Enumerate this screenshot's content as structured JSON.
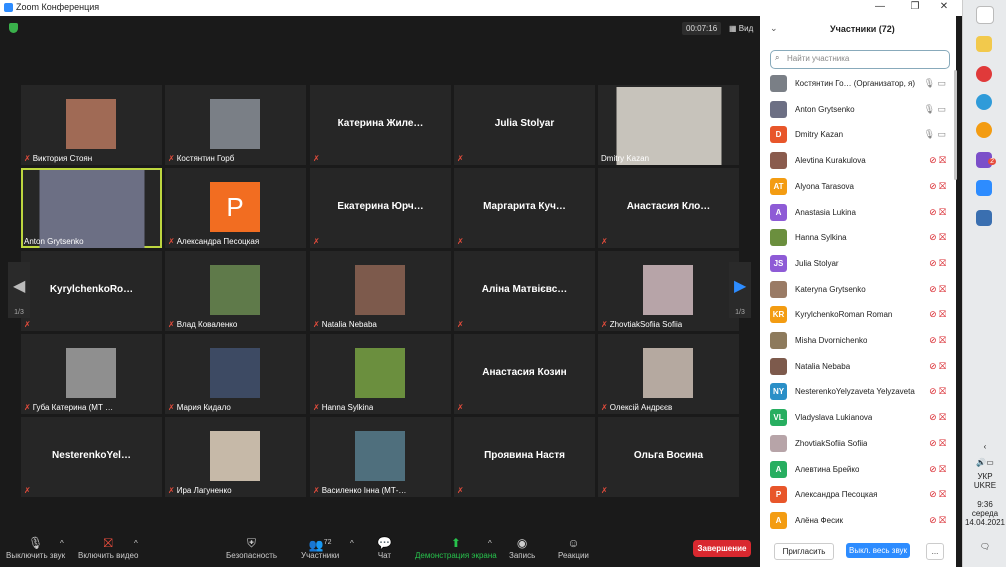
{
  "window": {
    "title": "Zoom Конференция"
  },
  "meeting": {
    "timer": "00:07:16",
    "view_label": "Вид",
    "page_indicator": "1/3",
    "tiles": [
      {
        "name": "Виктория Стоян",
        "kind": "photo",
        "color": "#a06a55"
      },
      {
        "name": "Костянтин Горб",
        "kind": "photo",
        "color": "#7a7f86"
      },
      {
        "name": "Катерина  Жиле…",
        "kind": "text"
      },
      {
        "name": "Julia Stolyar",
        "kind": "text"
      },
      {
        "name": "Dmitry Kazan",
        "kind": "video",
        "color": "#c7c3bb"
      },
      {
        "name": "Anton Grytsenko",
        "kind": "video",
        "color": "#6c6f84",
        "active": true
      },
      {
        "name": "Александра Песоцкая",
        "kind": "initial",
        "initial": "P"
      },
      {
        "name": "Екатерина  Юрч…",
        "kind": "text"
      },
      {
        "name": "Маргарита  Куч…",
        "kind": "text"
      },
      {
        "name": "Анастасия  Кло…",
        "kind": "text"
      },
      {
        "name": "KyrylchenkoRo…",
        "kind": "text"
      },
      {
        "name": "Влад Коваленко",
        "kind": "photo",
        "color": "#5f7a4a"
      },
      {
        "name": "Natalia Nebaba",
        "kind": "photo",
        "color": "#7d5a4c"
      },
      {
        "name": "Аліна  Матвієвс…",
        "kind": "text"
      },
      {
        "name": "ZhovtiakSofiia Sofiia",
        "kind": "photo",
        "color": "#b7a4a8"
      },
      {
        "name": "Губа Катерина (МТ …",
        "kind": "photo",
        "color": "#8f8f8f"
      },
      {
        "name": "Мария Кидало",
        "kind": "photo",
        "color": "#3d4a63"
      },
      {
        "name": "Hanna Sylkina",
        "kind": "photo",
        "color": "#6b8f3e"
      },
      {
        "name": "Анастасия Козин",
        "kind": "text"
      },
      {
        "name": "Олексій Андрєєв",
        "kind": "photo",
        "color": "#b5a9a0"
      },
      {
        "name": "NesterenkoYel…",
        "kind": "text"
      },
      {
        "name": "Ира Лагуненко",
        "kind": "photo",
        "color": "#c6b9a8"
      },
      {
        "name": "Василенко Інна (МТ-…",
        "kind": "photo",
        "color": "#4f6f7d"
      },
      {
        "name": "Проявина Настя",
        "kind": "text"
      },
      {
        "name": "Ольга Восина",
        "kind": "text"
      }
    ]
  },
  "toolbar": {
    "mute": "Выключить звук",
    "video": "Включить видео",
    "security": "Безопасность",
    "participants": "Участники",
    "participants_count": "72",
    "chat": "Чат",
    "share": "Демонстрация экрана",
    "record": "Запись",
    "reactions": "Реакции",
    "end": "Завершение"
  },
  "panel": {
    "title": "Участники (72)",
    "search_placeholder": "Найти участника",
    "participants": [
      {
        "name": "Костянтин Го… (Организатор, я)",
        "avatar": "photo",
        "color": "#7a7f86",
        "mic": "on"
      },
      {
        "name": "Anton Grytsenko",
        "avatar": "photo",
        "color": "#6c6f84",
        "mic": "on"
      },
      {
        "name": "Dmitry Kazan",
        "avatar": "D",
        "color": "#e8562a",
        "mic": "on"
      },
      {
        "name": "Alevtina Kurakulova",
        "avatar": "photo",
        "color": "#8a5b4d",
        "mic": "off"
      },
      {
        "name": "Alyona Tarasova",
        "avatar": "AT",
        "color": "#f39c12",
        "mic": "off"
      },
      {
        "name": "Anastasia Lukina",
        "avatar": "A",
        "color": "#8e5bd6",
        "mic": "off"
      },
      {
        "name": "Hanna Sylkina",
        "avatar": "photo",
        "color": "#6b8f3e",
        "mic": "off"
      },
      {
        "name": "Julia Stolyar",
        "avatar": "JS",
        "color": "#8e5bd6",
        "mic": "off"
      },
      {
        "name": "Kateryna Grytsenko",
        "avatar": "photo",
        "color": "#9a7b65",
        "mic": "off"
      },
      {
        "name": "KyrylchenkoRoman Roman",
        "avatar": "KR",
        "color": "#f39c12",
        "mic": "off"
      },
      {
        "name": "Misha Dvornichenko",
        "avatar": "photo",
        "color": "#8d7a5c",
        "mic": "off"
      },
      {
        "name": "Natalia Nebaba",
        "avatar": "photo",
        "color": "#7d5a4c",
        "mic": "off"
      },
      {
        "name": "NesterenkoYelyzaveta Yelyzaveta",
        "avatar": "NY",
        "color": "#2a8fc7",
        "mic": "off"
      },
      {
        "name": "Vladyslava Lukianova",
        "avatar": "VL",
        "color": "#27ae60",
        "mic": "off"
      },
      {
        "name": "ZhovtiakSofiia Sofiia",
        "avatar": "photo",
        "color": "#b7a4a8",
        "mic": "off"
      },
      {
        "name": "Алевтина Брейко",
        "avatar": "A",
        "color": "#27ae60",
        "mic": "off"
      },
      {
        "name": "Александра Песоцкая",
        "avatar": "P",
        "color": "#e8562a",
        "mic": "off"
      },
      {
        "name": "Алёна Фесик",
        "avatar": "A",
        "color": "#f39c12",
        "mic": "off"
      }
    ],
    "invite": "Пригласить",
    "mute_all": "Выкл. весь звук",
    "more": "..."
  },
  "taskbar": {
    "lang1": "УКР",
    "lang2": "UKRE",
    "time": "9:36",
    "day": "середа",
    "date": "14.04.2021",
    "badge": "2"
  }
}
